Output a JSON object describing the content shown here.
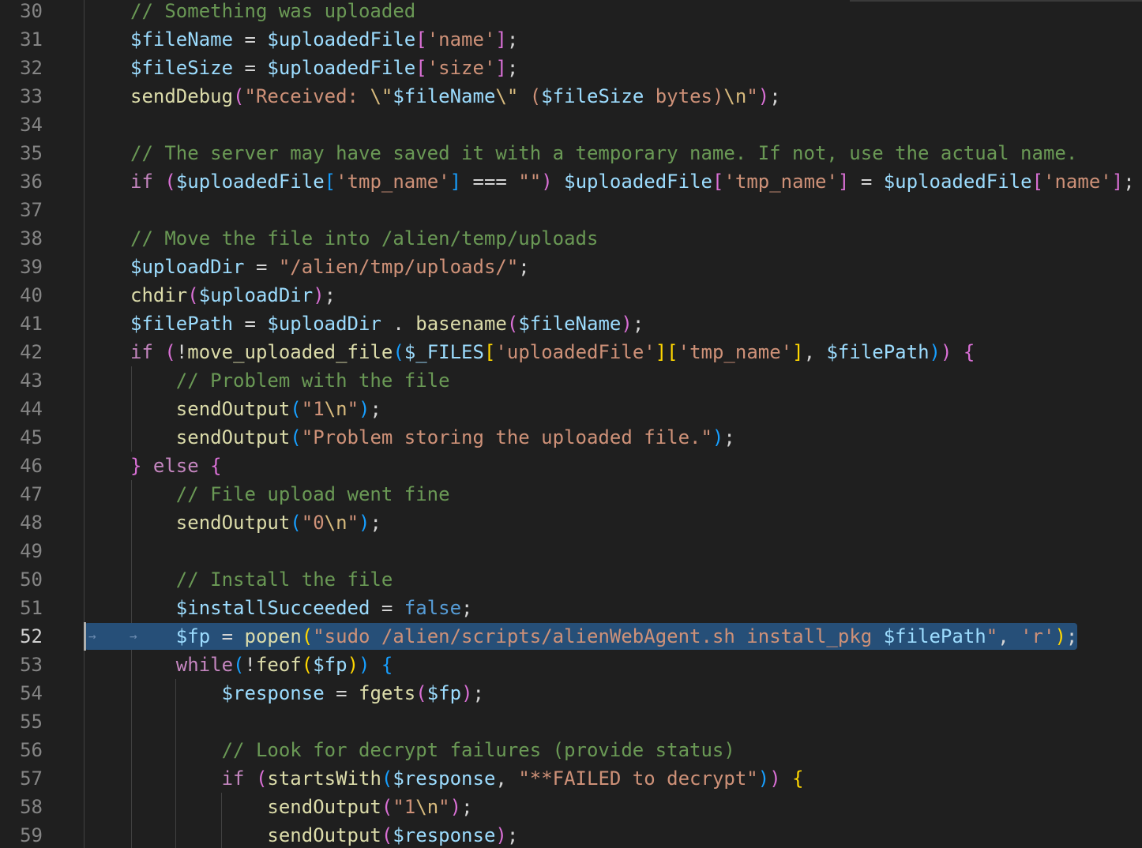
{
  "editor": {
    "active_line": "52",
    "lines": [
      {
        "n": "30",
        "tokens": [
          [
            "// Something was uploaded",
            "c"
          ]
        ]
      },
      {
        "n": "31",
        "tokens": [
          [
            "$fileName",
            "v"
          ],
          [
            " = ",
            "p"
          ],
          [
            "$uploadedFile",
            "v"
          ],
          [
            "[",
            "m"
          ],
          [
            "'name'",
            "s"
          ],
          [
            "]",
            "m"
          ],
          [
            ";",
            "p"
          ]
        ]
      },
      {
        "n": "32",
        "tokens": [
          [
            "$fileSize",
            "v"
          ],
          [
            " = ",
            "p"
          ],
          [
            "$uploadedFile",
            "v"
          ],
          [
            "[",
            "m"
          ],
          [
            "'size'",
            "s"
          ],
          [
            "]",
            "m"
          ],
          [
            ";",
            "p"
          ]
        ]
      },
      {
        "n": "33",
        "tokens": [
          [
            "sendDebug",
            "f"
          ],
          [
            "(",
            "m"
          ],
          [
            "\"Received: ",
            "s"
          ],
          [
            "\\\"",
            "e"
          ],
          [
            "$fileName",
            "v"
          ],
          [
            "\\\"",
            "e"
          ],
          [
            " (",
            "s"
          ],
          [
            "$fileSize",
            "v"
          ],
          [
            " bytes)",
            "s"
          ],
          [
            "\\n",
            "e"
          ],
          [
            "\"",
            "s"
          ],
          [
            ")",
            "m"
          ],
          [
            ";",
            "p"
          ]
        ]
      },
      {
        "n": "34",
        "tokens": []
      },
      {
        "n": "35",
        "tokens": [
          [
            "// The server may have saved it with a temporary name. If not, use the actual name.",
            "c"
          ]
        ]
      },
      {
        "n": "36",
        "tokens": [
          [
            "if ",
            "k"
          ],
          [
            "(",
            "m"
          ],
          [
            "$uploadedFile",
            "v"
          ],
          [
            "[",
            "bl"
          ],
          [
            "'tmp_name'",
            "s"
          ],
          [
            "]",
            "bl"
          ],
          [
            " === ",
            "p"
          ],
          [
            "\"\"",
            "s"
          ],
          [
            ")",
            "m"
          ],
          [
            " ",
            "p"
          ],
          [
            "$uploadedFile",
            "v"
          ],
          [
            "[",
            "m"
          ],
          [
            "'tmp_name'",
            "s"
          ],
          [
            "]",
            "m"
          ],
          [
            " = ",
            "p"
          ],
          [
            "$uploadedFile",
            "v"
          ],
          [
            "[",
            "m"
          ],
          [
            "'name'",
            "s"
          ],
          [
            "]",
            "m"
          ],
          [
            ";",
            "p"
          ]
        ]
      },
      {
        "n": "37",
        "tokens": []
      },
      {
        "n": "38",
        "tokens": [
          [
            "// Move the file into /alien/temp/uploads",
            "c"
          ]
        ]
      },
      {
        "n": "39",
        "tokens": [
          [
            "$uploadDir",
            "v"
          ],
          [
            " = ",
            "p"
          ],
          [
            "\"/alien/tmp/uploads/\"",
            "s"
          ],
          [
            ";",
            "p"
          ]
        ]
      },
      {
        "n": "40",
        "tokens": [
          [
            "chdir",
            "f"
          ],
          [
            "(",
            "m"
          ],
          [
            "$uploadDir",
            "v"
          ],
          [
            ")",
            "m"
          ],
          [
            ";",
            "p"
          ]
        ]
      },
      {
        "n": "41",
        "tokens": [
          [
            "$filePath",
            "v"
          ],
          [
            " = ",
            "p"
          ],
          [
            "$uploadDir",
            "v"
          ],
          [
            " . ",
            "p"
          ],
          [
            "basename",
            "f"
          ],
          [
            "(",
            "m"
          ],
          [
            "$fileName",
            "v"
          ],
          [
            ")",
            "m"
          ],
          [
            ";",
            "p"
          ]
        ]
      },
      {
        "n": "42",
        "tokens": [
          [
            "if ",
            "k"
          ],
          [
            "(",
            "m"
          ],
          [
            "!",
            "p"
          ],
          [
            "move_uploaded_file",
            "f"
          ],
          [
            "(",
            "bl"
          ],
          [
            "$_FILES",
            "v"
          ],
          [
            "[",
            "y"
          ],
          [
            "'uploadedFile'",
            "s"
          ],
          [
            "]",
            "y"
          ],
          [
            "[",
            "y"
          ],
          [
            "'tmp_name'",
            "s"
          ],
          [
            "]",
            "y"
          ],
          [
            ", ",
            "p"
          ],
          [
            "$filePath",
            "v"
          ],
          [
            ")",
            "bl"
          ],
          [
            ")",
            "m"
          ],
          [
            " ",
            "p"
          ],
          [
            "{",
            "m"
          ]
        ]
      },
      {
        "n": "43",
        "tokens": [
          [
            "    ",
            "p"
          ],
          [
            "// Problem with the file",
            "c"
          ]
        ]
      },
      {
        "n": "44",
        "tokens": [
          [
            "    ",
            "p"
          ],
          [
            "sendOutput",
            "f"
          ],
          [
            "(",
            "bl"
          ],
          [
            "\"1",
            "s"
          ],
          [
            "\\n",
            "e"
          ],
          [
            "\"",
            "s"
          ],
          [
            ")",
            "bl"
          ],
          [
            ";",
            "p"
          ]
        ]
      },
      {
        "n": "45",
        "tokens": [
          [
            "    ",
            "p"
          ],
          [
            "sendOutput",
            "f"
          ],
          [
            "(",
            "bl"
          ],
          [
            "\"Problem storing the uploaded file.\"",
            "s"
          ],
          [
            ")",
            "bl"
          ],
          [
            ";",
            "p"
          ]
        ]
      },
      {
        "n": "46",
        "tokens": [
          [
            "}",
            "m"
          ],
          [
            " else ",
            "k"
          ],
          [
            "{",
            "m"
          ]
        ]
      },
      {
        "n": "47",
        "tokens": [
          [
            "    ",
            "p"
          ],
          [
            "// File upload went fine",
            "c"
          ]
        ]
      },
      {
        "n": "48",
        "tokens": [
          [
            "    ",
            "p"
          ],
          [
            "sendOutput",
            "f"
          ],
          [
            "(",
            "bl"
          ],
          [
            "\"0",
            "s"
          ],
          [
            "\\n",
            "e"
          ],
          [
            "\"",
            "s"
          ],
          [
            ")",
            "bl"
          ],
          [
            ";",
            "p"
          ]
        ]
      },
      {
        "n": "49",
        "tokens": []
      },
      {
        "n": "50",
        "tokens": [
          [
            "    ",
            "p"
          ],
          [
            "// Install the file",
            "c"
          ]
        ]
      },
      {
        "n": "51",
        "tokens": [
          [
            "    ",
            "p"
          ],
          [
            "$installSucceeded",
            "v"
          ],
          [
            " = ",
            "p"
          ],
          [
            "false",
            "b"
          ],
          [
            ";",
            "p"
          ]
        ]
      },
      {
        "n": "52",
        "tokens": [
          [
            "    ",
            "p"
          ],
          [
            "$fp",
            "v"
          ],
          [
            " = ",
            "p"
          ],
          [
            "popen",
            "f"
          ],
          [
            "(",
            "y"
          ],
          [
            "\"sudo /alien/scripts/alienWebAgent.sh install_pkg ",
            "s"
          ],
          [
            "$filePath",
            "v"
          ],
          [
            "\"",
            "s"
          ],
          [
            ", ",
            "p"
          ],
          [
            "'r'",
            "s"
          ],
          [
            ")",
            "y"
          ],
          [
            ";",
            "p"
          ]
        ]
      },
      {
        "n": "53",
        "tokens": [
          [
            "    ",
            "p"
          ],
          [
            "while",
            "k"
          ],
          [
            "(",
            "bl"
          ],
          [
            "!",
            "p"
          ],
          [
            "feof",
            "f"
          ],
          [
            "(",
            "y"
          ],
          [
            "$fp",
            "v"
          ],
          [
            ")",
            "y"
          ],
          [
            ")",
            "bl"
          ],
          [
            " ",
            "p"
          ],
          [
            "{",
            "bl"
          ]
        ]
      },
      {
        "n": "54",
        "tokens": [
          [
            "        ",
            "p"
          ],
          [
            "$response",
            "v"
          ],
          [
            " = ",
            "p"
          ],
          [
            "fgets",
            "f"
          ],
          [
            "(",
            "m"
          ],
          [
            "$fp",
            "v"
          ],
          [
            ")",
            "m"
          ],
          [
            ";",
            "p"
          ]
        ]
      },
      {
        "n": "55",
        "tokens": []
      },
      {
        "n": "56",
        "tokens": [
          [
            "        ",
            "p"
          ],
          [
            "// Look for decrypt failures (provide status)",
            "c"
          ]
        ]
      },
      {
        "n": "57",
        "tokens": [
          [
            "        ",
            "p"
          ],
          [
            "if ",
            "k"
          ],
          [
            "(",
            "m"
          ],
          [
            "startsWith",
            "f"
          ],
          [
            "(",
            "bl"
          ],
          [
            "$response",
            "v"
          ],
          [
            ", ",
            "p"
          ],
          [
            "\"**FAILED to decrypt\"",
            "s"
          ],
          [
            ")",
            "bl"
          ],
          [
            ")",
            "m"
          ],
          [
            " ",
            "p"
          ],
          [
            "{",
            "y"
          ]
        ]
      },
      {
        "n": "58",
        "tokens": [
          [
            "            ",
            "p"
          ],
          [
            "sendOutput",
            "f"
          ],
          [
            "(",
            "m"
          ],
          [
            "\"1",
            "s"
          ],
          [
            "\\n",
            "e"
          ],
          [
            "\"",
            "s"
          ],
          [
            ")",
            "m"
          ],
          [
            ";",
            "p"
          ]
        ]
      },
      {
        "n": "59",
        "tokens": [
          [
            "            ",
            "p"
          ],
          [
            "sendOutput",
            "f"
          ],
          [
            "(",
            "m"
          ],
          [
            "$response",
            "v"
          ],
          [
            ")",
            "m"
          ],
          [
            ";",
            "p"
          ]
        ]
      }
    ]
  }
}
